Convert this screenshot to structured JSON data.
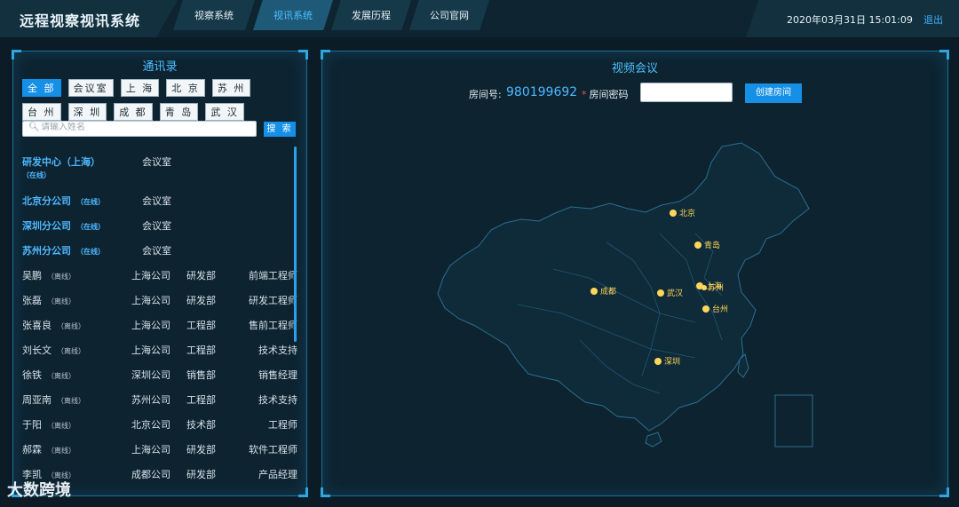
{
  "header": {
    "app_title": "远程视察视讯系统",
    "nav": [
      "视察系统",
      "视讯系统",
      "发展历程",
      "公司官网"
    ],
    "active_nav": "视讯系统",
    "datetime": "2020年03月31日 15:01:09",
    "logout": "退出"
  },
  "contacts": {
    "title": "通讯录",
    "filters": [
      "全 部",
      "会议室",
      "上 海",
      "北 京",
      "苏 州",
      "台 州",
      "深 圳",
      "成 都",
      "青 岛",
      "武 汉"
    ],
    "active_filter": "全 部",
    "search_placeholder": "请输入姓名",
    "search_button": "搜 索",
    "rooms": [
      {
        "name": "研发中心（上海）",
        "status": "（在线）",
        "type": "会议室"
      },
      {
        "name": "北京分公司",
        "status": "（在线）",
        "type": "会议室"
      },
      {
        "name": "深圳分公司",
        "status": "（在线）",
        "type": "会议室"
      },
      {
        "name": "苏州分公司",
        "status": "（在线）",
        "type": "会议室"
      }
    ],
    "people": [
      {
        "name": "吴鹏",
        "status": "（离线）",
        "company": "上海公司",
        "dept": "研发部",
        "title": "前端工程师"
      },
      {
        "name": "张磊",
        "status": "（离线）",
        "company": "上海公司",
        "dept": "研发部",
        "title": "研发工程师"
      },
      {
        "name": "张喜良",
        "status": "（离线）",
        "company": "上海公司",
        "dept": "工程部",
        "title": "售前工程师"
      },
      {
        "name": "刘长文",
        "status": "（离线）",
        "company": "上海公司",
        "dept": "工程部",
        "title": "技术支持"
      },
      {
        "name": "徐铁",
        "status": "（离线）",
        "company": "深圳公司",
        "dept": "销售部",
        "title": "销售经理"
      },
      {
        "name": "周亚南",
        "status": "（离线）",
        "company": "苏州公司",
        "dept": "工程部",
        "title": "技术支持"
      },
      {
        "name": "于阳",
        "status": "（离线）",
        "company": "北京公司",
        "dept": "技术部",
        "title": "工程师"
      },
      {
        "name": "郝霖",
        "status": "（离线）",
        "company": "上海公司",
        "dept": "研发部",
        "title": "软件工程师"
      },
      {
        "name": "李凯",
        "status": "（离线）",
        "company": "成都公司",
        "dept": "研发部",
        "title": "产品经理"
      }
    ]
  },
  "meeting": {
    "title": "视频会议",
    "room_label": "房间号:",
    "room_number": "980199692",
    "password_label": "房间密码",
    "password_value": "",
    "create_button": "创建房间",
    "cities": [
      "北京",
      "青岛",
      "上海",
      "苏州",
      "成都",
      "武汉",
      "台州",
      "深圳"
    ],
    "marker_color": "#ffd65a",
    "map_line_color": "#2a6f92"
  },
  "watermark": "大数跨境"
}
